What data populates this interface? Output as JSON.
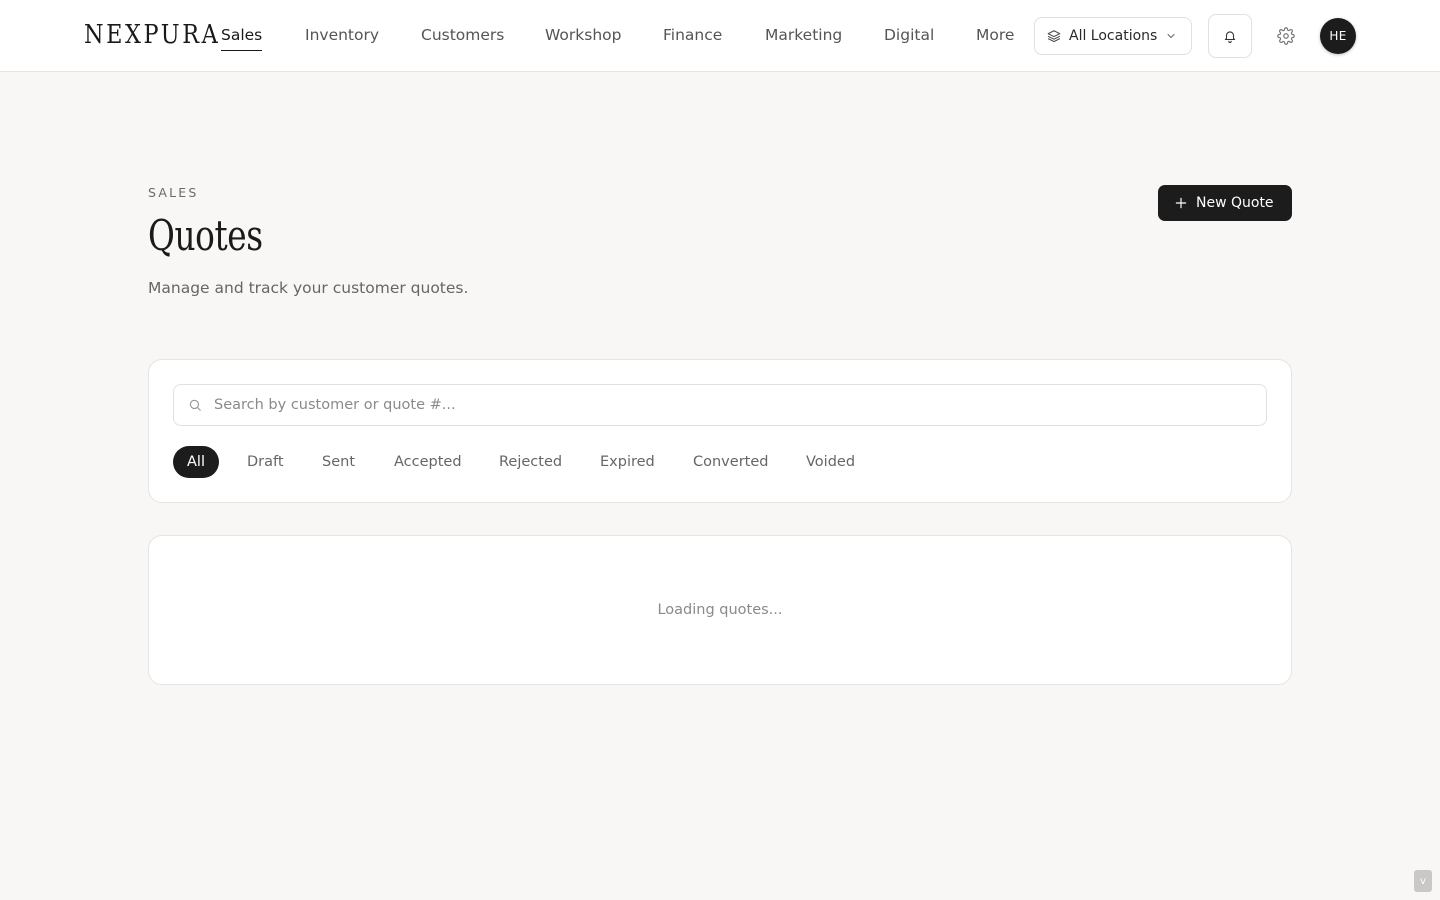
{
  "brand": {
    "name": "NEXPURA"
  },
  "nav": {
    "items": [
      {
        "label": "Sales",
        "active": true
      },
      {
        "label": "Inventory"
      },
      {
        "label": "Customers"
      },
      {
        "label": "Workshop"
      },
      {
        "label": "Finance"
      },
      {
        "label": "Marketing"
      },
      {
        "label": "Digital"
      },
      {
        "label": "More"
      }
    ],
    "location": {
      "label": "All Locations",
      "icon": "layers-icon"
    },
    "avatar": {
      "initials": "HE"
    }
  },
  "header": {
    "eyebrow": "SALES",
    "title": "Quotes",
    "subtitle": "Manage and track your customer quotes.",
    "new_button": "New Quote"
  },
  "filters": {
    "search_placeholder": "Search by customer or quote #...",
    "search_value": "",
    "statuses": [
      {
        "label": "All",
        "active": true
      },
      {
        "label": "Draft"
      },
      {
        "label": "Sent"
      },
      {
        "label": "Accepted"
      },
      {
        "label": "Rejected"
      },
      {
        "label": "Expired"
      },
      {
        "label": "Converted"
      },
      {
        "label": "Voided"
      }
    ]
  },
  "list": {
    "loading_text": "Loading quotes..."
  },
  "corner": {
    "label": "v"
  },
  "colors": {
    "background": "#f8f7f5",
    "accent": "#1c1c1c",
    "muted_text": "#666666"
  }
}
